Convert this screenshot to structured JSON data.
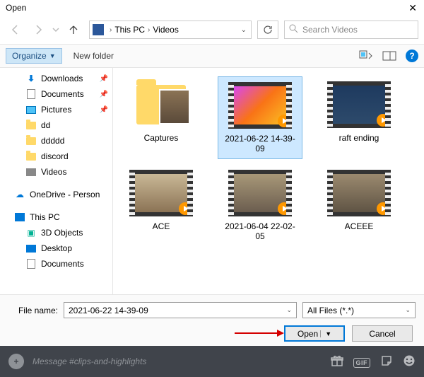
{
  "titlebar": {
    "title": "Open"
  },
  "nav": {
    "crumb1": "This PC",
    "crumb2": "Videos",
    "search_placeholder": "Search Videos"
  },
  "toolbar": {
    "organize": "Organize",
    "newfolder": "New folder",
    "help": "?"
  },
  "sidebar": {
    "quick": [
      {
        "label": "Downloads",
        "icon": "download",
        "pinned": true
      },
      {
        "label": "Documents",
        "icon": "document",
        "pinned": true
      },
      {
        "label": "Pictures",
        "icon": "pictures",
        "pinned": true
      },
      {
        "label": "dd",
        "icon": "folder",
        "pinned": false
      },
      {
        "label": "ddddd",
        "icon": "folder",
        "pinned": false
      },
      {
        "label": "discord",
        "icon": "folder",
        "pinned": false
      },
      {
        "label": "Videos",
        "icon": "videos",
        "pinned": false
      }
    ],
    "onedrive": "OneDrive - Person",
    "thispc": "This PC",
    "thispc_children": [
      {
        "label": "3D Objects",
        "icon": "cube"
      },
      {
        "label": "Desktop",
        "icon": "desktop"
      },
      {
        "label": "Documents",
        "icon": "document"
      }
    ]
  },
  "files": [
    {
      "label": "Captures",
      "type": "folder"
    },
    {
      "label": "2021-06-22 14-39-09",
      "type": "video",
      "thumb": "c1",
      "selected": true
    },
    {
      "label": "raft ending",
      "type": "video",
      "thumb": "c2"
    },
    {
      "label": "ACE",
      "type": "video",
      "thumb": "c3"
    },
    {
      "label": "2021-06-04 22-02-05",
      "type": "video",
      "thumb": "c4"
    },
    {
      "label": "ACEEE",
      "type": "video",
      "thumb": "c5"
    }
  ],
  "bottom": {
    "filename_label": "File name:",
    "filename_value": "2021-06-22 14-39-09",
    "filter": "All Files (*.*)",
    "open": "Open",
    "cancel": "Cancel"
  },
  "discord": {
    "placeholder": "Message #clips-and-highlights",
    "gif": "GIF"
  }
}
